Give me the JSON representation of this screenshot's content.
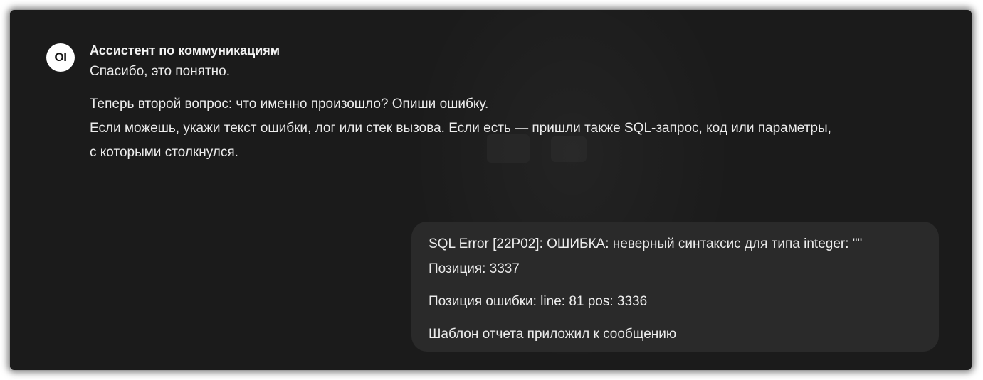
{
  "assistant": {
    "avatar_text": "OI",
    "name": "Ассистент по коммуникациям",
    "message": {
      "line1": "Спасибо, это понятно.",
      "line2": "Теперь второй вопрос: что именно произошло? Опиши ошибку.",
      "line3": "Если можешь, укажи текст ошибки, лог или стек вызова. Если есть — пришли также SQL-запрос, код или параметры,",
      "line4": "с которыми столкнулся."
    }
  },
  "user": {
    "message": {
      "line1": "SQL Error [22P02]: ОШИБКА: неверный синтаксис для типа integer: \"\"",
      "line2": "Позиция: 3337",
      "line3": "Позиция ошибки: line: 81 pos: 3336",
      "line4": "Шаблон отчета приложил к сообщению"
    }
  },
  "colors": {
    "background": "#1b1b1b",
    "bubble": "#2a2a2a",
    "text": "#ececec",
    "avatar_bg": "#ffffff"
  }
}
